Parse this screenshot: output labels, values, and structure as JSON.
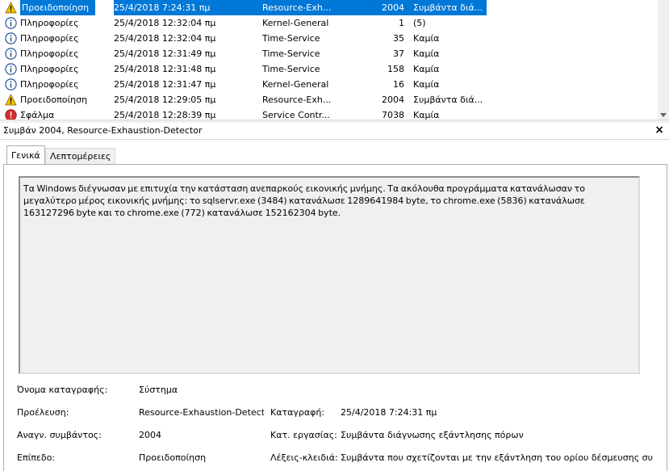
{
  "events": [
    {
      "level": "Προειδοποίηση",
      "icon": "warning",
      "date": "25/4/2018 7:24:31 πμ",
      "source": "Resource-Exh...",
      "id": "2004",
      "task": "Συμβάντα διά...",
      "selected": true
    },
    {
      "level": "Πληροφορίες",
      "icon": "info",
      "date": "25/4/2018 12:32:04 πμ",
      "source": "Kernel-General",
      "id": "1",
      "task": "(5)"
    },
    {
      "level": "Πληροφορίες",
      "icon": "info",
      "date": "25/4/2018 12:32:04 πμ",
      "source": "Time-Service",
      "id": "35",
      "task": "Καμία"
    },
    {
      "level": "Πληροφορίες",
      "icon": "info",
      "date": "25/4/2018 12:31:49 πμ",
      "source": "Time-Service",
      "id": "37",
      "task": "Καμία"
    },
    {
      "level": "Πληροφορίες",
      "icon": "info",
      "date": "25/4/2018 12:31:48 πμ",
      "source": "Time-Service",
      "id": "158",
      "task": "Καμία"
    },
    {
      "level": "Πληροφορίες",
      "icon": "info",
      "date": "25/4/2018 12:31:47 πμ",
      "source": "Kernel-General",
      "id": "16",
      "task": "Καμία"
    },
    {
      "level": "Προειδοποίηση",
      "icon": "warning",
      "date": "25/4/2018 12:29:05 πμ",
      "source": "Resource-Exh...",
      "id": "2004",
      "task": "Συμβάντα διά..."
    },
    {
      "level": "Σφάλμα",
      "icon": "error",
      "date": "25/4/2018 12:28:39 πμ",
      "source": "Service Contr...",
      "id": "7038",
      "task": "Καμία"
    }
  ],
  "details": {
    "title": "Συμβάν 2004, Resource-Exhaustion-Detector",
    "close": "×",
    "tabs": {
      "general": "Γενικά",
      "details": "Λεπτομέρειες"
    },
    "description": "Τα Windows διέγνωσαν με επιτυχία την κατάσταση ανεπαρκούς εικονικής μνήμης. Τα ακόλουθα προγράμματα κατανάλωσαν το μεγαλύτερο μέρος εικονικής μνήμης: το sqlservr.exe (3484) κατανάλωσε 1289641984 byte, το chrome.exe (5836) κατανάλωσε 163127296 byte και το chrome.exe (772) κατανάλωσε 152162304 byte.",
    "log_name_label": "Όνομα καταγραφής:",
    "log_name": "Σύστημα",
    "source_label": "Προέλευση:",
    "source": "Resource-Exhaustion-Detector",
    "logged_label": "Καταγραφή:",
    "logged": "25/4/2018 7:24:31 πμ",
    "event_id_label": "Αναγν. συμβάντος:",
    "event_id": "2004",
    "task_label": "Κατ. εργασίας:",
    "task": "Συμβάντα διάγνωσης εξάντλησης πόρων",
    "level_label": "Επίπεδο:",
    "level": "Προειδοποίηση",
    "keywords_label": "Λέξεις-κλειδιά:",
    "keywords": "Συμβάντα που σχετίζονται με την εξάντληση του ορίου δέσμευσης συ"
  }
}
